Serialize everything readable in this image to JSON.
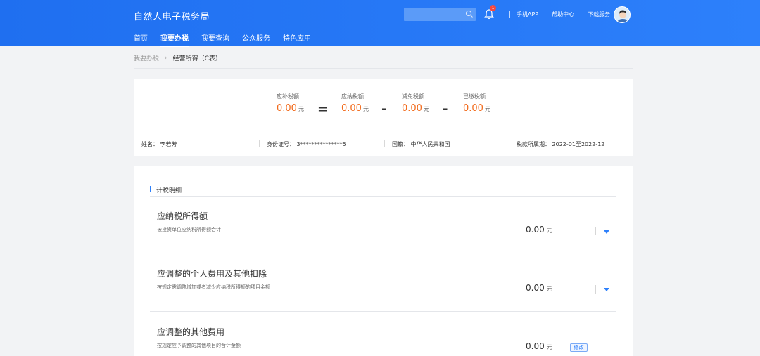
{
  "header": {
    "brand": "自然人电子税务局",
    "nav": [
      "首页",
      "我要办税",
      "我要查询",
      "公众服务",
      "特色应用"
    ],
    "search_placeholder": "",
    "notification_count": "1",
    "links": [
      "手机APP",
      "帮助中心",
      "下载服务"
    ]
  },
  "breadcrumb": {
    "parent": "我要办税",
    "current": "经营所得（C表）"
  },
  "summary": {
    "items": [
      {
        "label": "应补税额",
        "value": "0.00",
        "unit": "元"
      },
      {
        "label": "应纳税额",
        "value": "0.00",
        "unit": "元"
      },
      {
        "label": "减免税额",
        "value": "0.00",
        "unit": "元"
      },
      {
        "label": "已缴税额",
        "value": "0.00",
        "unit": "元"
      }
    ],
    "operators": [
      "=",
      "-",
      "-"
    ]
  },
  "info": {
    "name": "姓名：  李若芳",
    "id": "身份证号：  3***************5",
    "nationality": "国籍：  中华人民共和国",
    "period": "税款所属期：  2022-01至2022-12"
  },
  "details": {
    "section_title": "计税明细",
    "rows": [
      {
        "title": "应纳税所得额",
        "desc": "被投资单位应纳税所得额合计",
        "value": "0.00",
        "unit": "元"
      },
      {
        "title": "应调整的个人费用及其他扣除",
        "desc": "按规定需调整增加或者减少应纳税所得额的项目金额",
        "value": "0.00",
        "unit": "元"
      },
      {
        "title": "应调整的其他费用",
        "desc": "按规定应予调整的其他项目的合计金额",
        "value": "0.00",
        "unit": "元",
        "action": "修改"
      }
    ]
  },
  "colors": {
    "header_blue": "#2d80fb",
    "amount_orange": "#f26a1b"
  }
}
